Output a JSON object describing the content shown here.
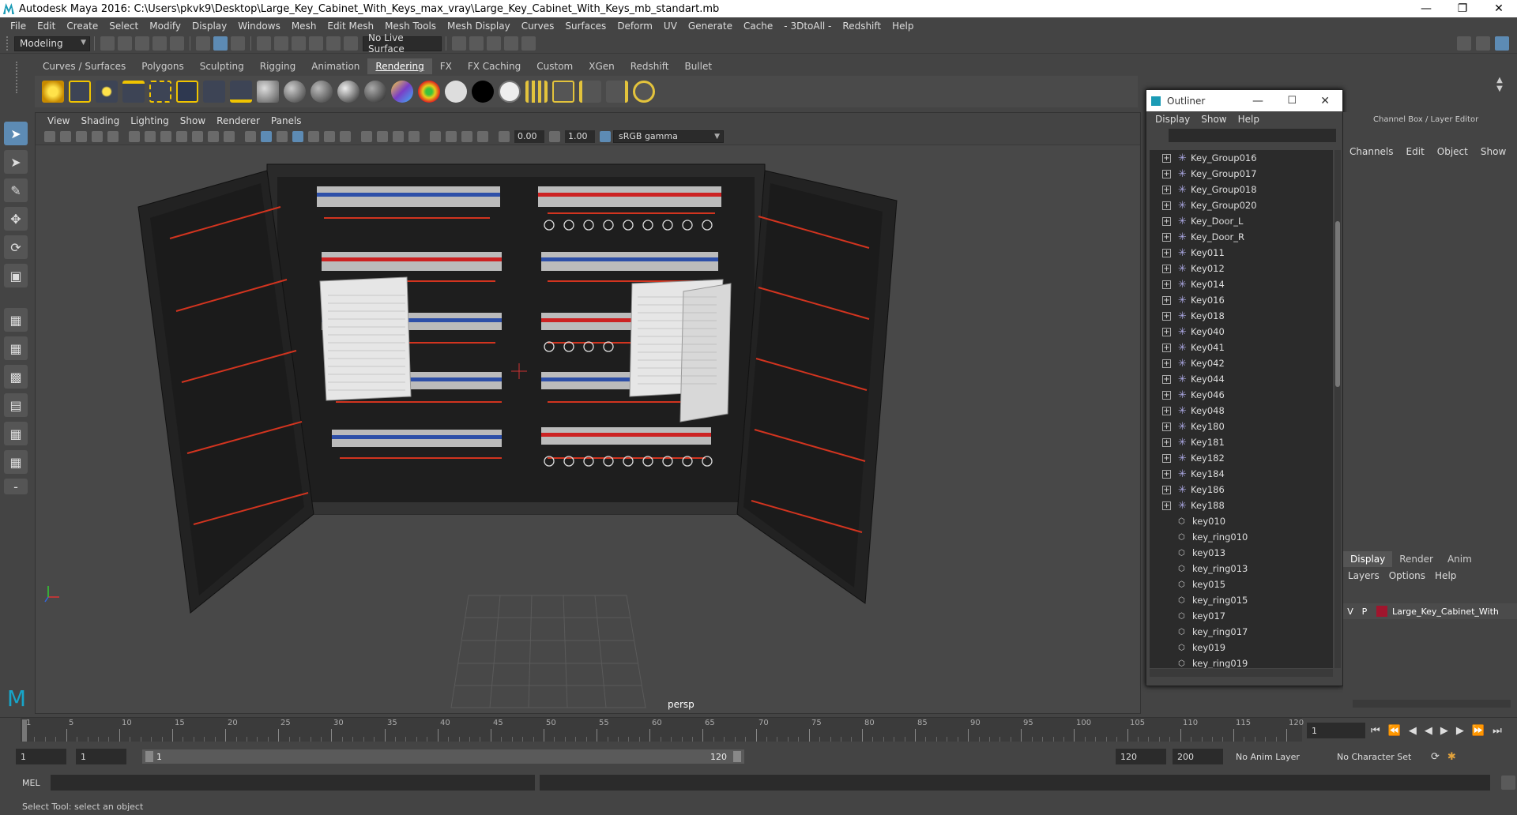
{
  "window": {
    "title": "Autodesk Maya 2016: C:\\Users\\pkvk9\\Desktop\\Large_Key_Cabinet_With_Keys_max_vray\\Large_Key_Cabinet_With_Keys_mb_standart.mb"
  },
  "menubar": [
    "File",
    "Edit",
    "Create",
    "Select",
    "Modify",
    "Display",
    "Windows",
    "Mesh",
    "Edit Mesh",
    "Mesh Tools",
    "Mesh Display",
    "Curves",
    "Surfaces",
    "Deform",
    "UV",
    "Generate",
    "Cache",
    "- 3DtoAll -",
    "Redshift",
    "Help"
  ],
  "statusline": {
    "mode": "Modeling",
    "live_surface": "No Live Surface"
  },
  "shelf_tabs": [
    "Curves / Surfaces",
    "Polygons",
    "Sculpting",
    "Rigging",
    "Animation",
    "Rendering",
    "FX",
    "FX Caching",
    "Custom",
    "XGen",
    "Redshift",
    "Bullet"
  ],
  "shelf_active_tab": "Rendering",
  "viewport": {
    "menu": [
      "View",
      "Shading",
      "Lighting",
      "Show",
      "Renderer",
      "Panels"
    ],
    "field1": "0.00",
    "field2": "1.00",
    "color_space": "sRGB gamma",
    "camera_label": "persp"
  },
  "outliner": {
    "title": "Outliner",
    "menu": [
      "Display",
      "Show",
      "Help"
    ],
    "items": [
      {
        "name": "Key_Group016",
        "type": "joint",
        "expand": true
      },
      {
        "name": "Key_Group017",
        "type": "joint",
        "expand": true
      },
      {
        "name": "Key_Group018",
        "type": "joint",
        "expand": true
      },
      {
        "name": "Key_Group020",
        "type": "joint",
        "expand": true
      },
      {
        "name": "Key_Door_L",
        "type": "joint",
        "expand": true
      },
      {
        "name": "Key_Door_R",
        "type": "joint",
        "expand": true
      },
      {
        "name": "Key011",
        "type": "joint",
        "expand": true
      },
      {
        "name": "Key012",
        "type": "joint",
        "expand": true
      },
      {
        "name": "Key014",
        "type": "joint",
        "expand": true
      },
      {
        "name": "Key016",
        "type": "joint",
        "expand": true
      },
      {
        "name": "Key018",
        "type": "joint",
        "expand": true
      },
      {
        "name": "Key040",
        "type": "joint",
        "expand": true
      },
      {
        "name": "Key041",
        "type": "joint",
        "expand": true
      },
      {
        "name": "Key042",
        "type": "joint",
        "expand": true
      },
      {
        "name": "Key044",
        "type": "joint",
        "expand": true
      },
      {
        "name": "Key046",
        "type": "joint",
        "expand": true
      },
      {
        "name": "Key048",
        "type": "joint",
        "expand": true
      },
      {
        "name": "Key180",
        "type": "joint",
        "expand": true
      },
      {
        "name": "Key181",
        "type": "joint",
        "expand": true
      },
      {
        "name": "Key182",
        "type": "joint",
        "expand": true
      },
      {
        "name": "Key184",
        "type": "joint",
        "expand": true
      },
      {
        "name": "Key186",
        "type": "joint",
        "expand": true
      },
      {
        "name": "Key188",
        "type": "joint",
        "expand": true
      },
      {
        "name": "key010",
        "type": "mesh",
        "expand": false
      },
      {
        "name": "key_ring010",
        "type": "mesh",
        "expand": false
      },
      {
        "name": "key013",
        "type": "mesh",
        "expand": false
      },
      {
        "name": "key_ring013",
        "type": "mesh",
        "expand": false
      },
      {
        "name": "key015",
        "type": "mesh",
        "expand": false
      },
      {
        "name": "key_ring015",
        "type": "mesh",
        "expand": false
      },
      {
        "name": "key017",
        "type": "mesh",
        "expand": false
      },
      {
        "name": "key_ring017",
        "type": "mesh",
        "expand": false
      },
      {
        "name": "key019",
        "type": "mesh",
        "expand": false
      },
      {
        "name": "key_ring019",
        "type": "mesh",
        "expand": false
      }
    ]
  },
  "channelbox": {
    "header": "Channel Box / Layer Editor",
    "menu": [
      "Channels",
      "Edit",
      "Object",
      "Show"
    ],
    "layer_tabs": [
      "Display",
      "Render",
      "Anim"
    ],
    "layer_menu": [
      "Layers",
      "Options",
      "Help"
    ],
    "layer": {
      "v": "V",
      "p": "P",
      "name": "Large_Key_Cabinet_With",
      "color": "#a0152d"
    }
  },
  "timeline": {
    "ticks": [
      "1",
      "5",
      "10",
      "15",
      "20",
      "25",
      "30",
      "35",
      "40",
      "45",
      "50",
      "55",
      "60",
      "65",
      "70",
      "75",
      "80",
      "85",
      "90",
      "95",
      "100",
      "105",
      "110",
      "115",
      "120"
    ],
    "current_frame": "1"
  },
  "range": {
    "start": "1",
    "start2": "1",
    "slider_start": "1",
    "slider_end": "120",
    "end": "120",
    "end2": "200",
    "anim_layer": "No Anim Layer",
    "char_set": "No Character Set"
  },
  "cmdline": {
    "label": "MEL"
  },
  "helpline": "Select Tool: select an object"
}
